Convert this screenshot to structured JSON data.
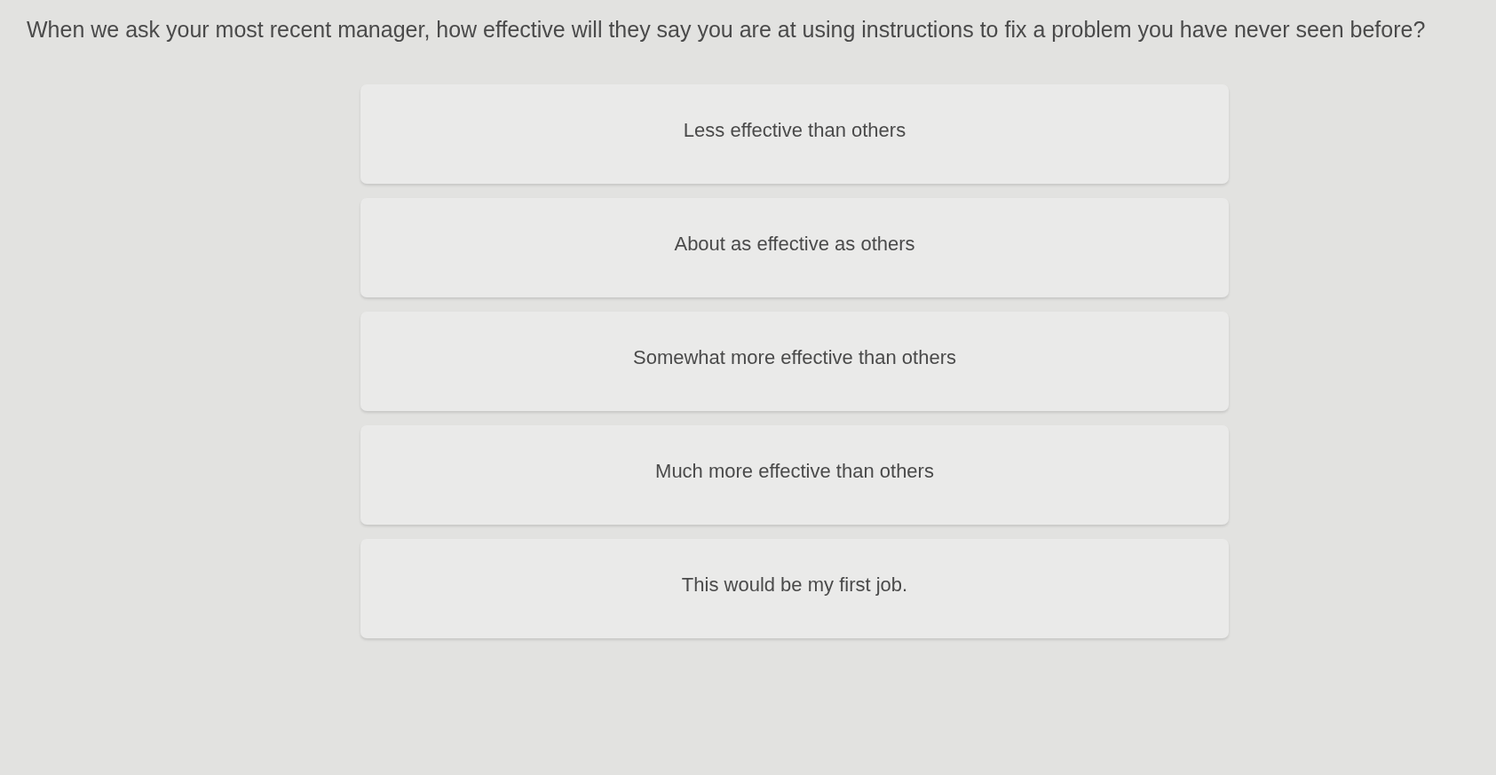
{
  "question": "When we ask your most recent manager, how effective will they say you are at using instructions to fix a problem you have never seen before?",
  "options": [
    {
      "label": "Less effective than others",
      "selected": false
    },
    {
      "label": "About as effective as others",
      "selected": false
    },
    {
      "label": "Somewhat more effective than others",
      "selected": false
    },
    {
      "label": "Much more effective than others",
      "selected": false
    },
    {
      "label": "This would be my first job.",
      "selected": false
    }
  ]
}
